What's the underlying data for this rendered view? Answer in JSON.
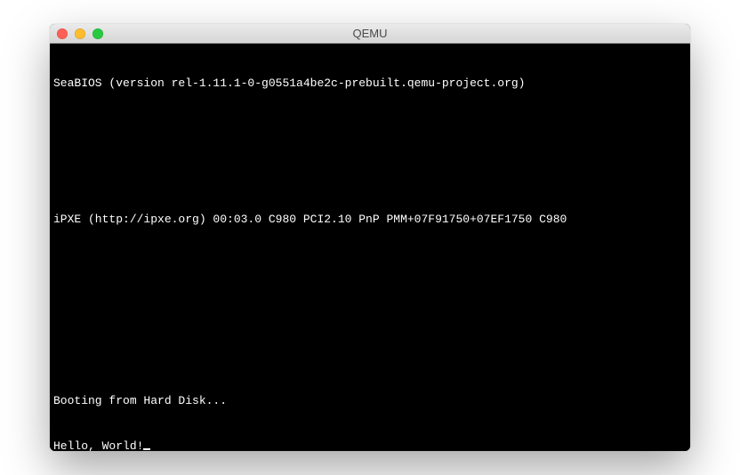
{
  "window": {
    "title": "QEMU"
  },
  "terminal": {
    "lines": [
      "SeaBIOS (version rel-1.11.1-0-g0551a4be2c-prebuilt.qemu-project.org)",
      "",
      "",
      "iPXE (http://ipxe.org) 00:03.0 C980 PCI2.10 PnP PMM+07F91750+07EF1750 C980",
      "",
      "",
      "",
      "Booting from Hard Disk...",
      "Hello, World!"
    ]
  }
}
